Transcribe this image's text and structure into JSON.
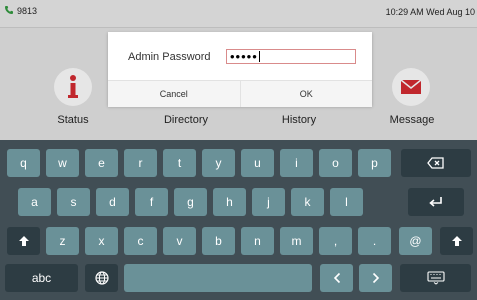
{
  "status_bar": {
    "extension": "9813",
    "datetime": "10:29 AM Wed Aug 10"
  },
  "home": {
    "items": [
      {
        "label": "Status",
        "icon": "info-icon"
      },
      {
        "label": "Directory",
        "icon": "directory-icon"
      },
      {
        "label": "History",
        "icon": "history-icon"
      },
      {
        "label": "Message",
        "icon": "envelope-icon"
      }
    ]
  },
  "dialog": {
    "label": "Admin Password",
    "password_value": "•••••",
    "cancel_label": "Cancel",
    "ok_label": "OK"
  },
  "keyboard": {
    "row1": [
      "q",
      "w",
      "e",
      "r",
      "t",
      "y",
      "u",
      "i",
      "o",
      "p"
    ],
    "row2": [
      "a",
      "s",
      "d",
      "f",
      "g",
      "h",
      "j",
      "k",
      "l"
    ],
    "row3": [
      "z",
      "x",
      "c",
      "v",
      "b",
      "n",
      "m",
      ",",
      ".",
      "@"
    ],
    "abc_label": "abc"
  },
  "colors": {
    "key": "#6a9198",
    "key_dark": "#2d3c43",
    "keyboard_bg": "#414e55",
    "accent_red": "#c0272d"
  }
}
